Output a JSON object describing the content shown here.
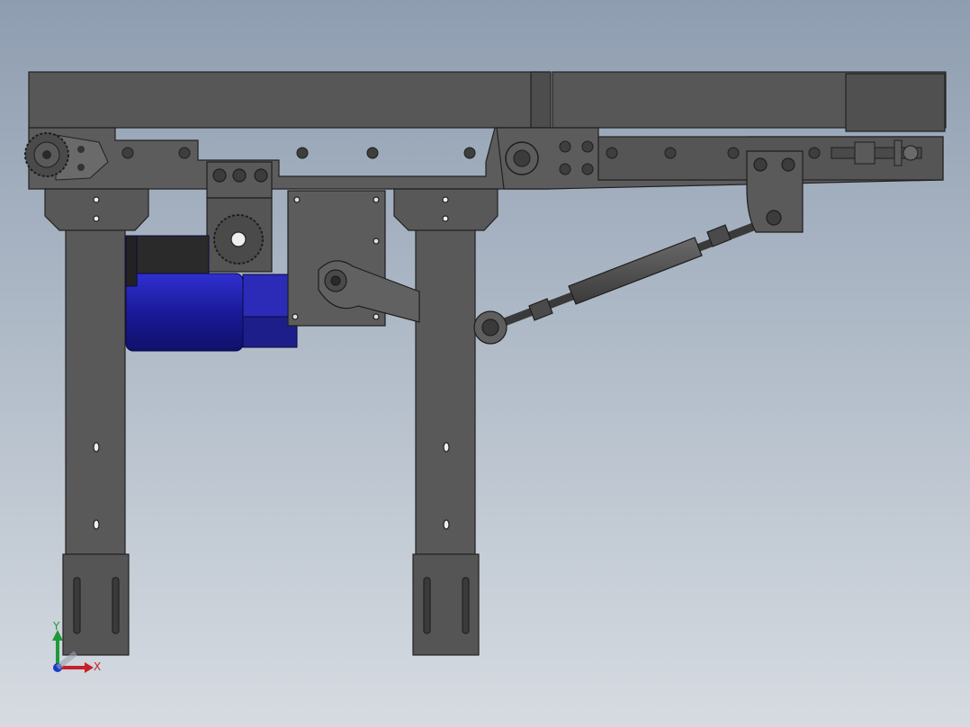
{
  "window": {
    "title": ""
  },
  "model": {
    "description_visible_text": "",
    "colors": {
      "background_top": "#8e9db0",
      "background_bottom": "#d6dbe1",
      "frame": "#5a5a5a",
      "frame_dark": "#3f3f3f",
      "frame_edge": "#2a2a2a",
      "motor": "#1a1a9a",
      "motor_light": "#2b2bc8",
      "bolt": "#4a4a4a"
    }
  },
  "triad": {
    "x_label": "X",
    "y_label": "Y",
    "x_color": "#c8202a",
    "y_color": "#1e9a3a",
    "z_color": "#1a3acc"
  }
}
